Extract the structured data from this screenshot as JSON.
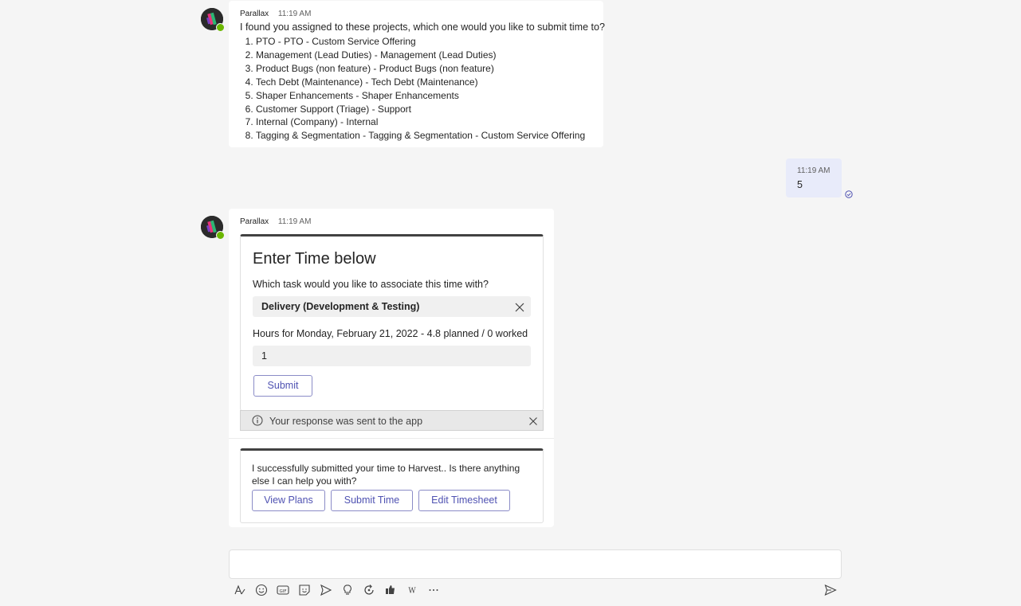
{
  "bot": {
    "name": "Parallax",
    "avatar_icon": "parallax-bot-icon",
    "presence_color": "#6bb700"
  },
  "message1": {
    "time": "11:19 AM",
    "text": "I found you assigned to these projects, which one would you like to submit time to?",
    "projects": [
      "PTO - PTO - Custom Service Offering",
      "Management (Lead Duties) - Management (Lead Duties)",
      "Product Bugs (non feature) - Product Bugs (non feature)",
      "Tech Debt (Maintenance) - Tech Debt (Maintenance)",
      "Shaper Enhancements - Shaper Enhancements",
      "Customer Support (Triage) - Support",
      "Internal (Company) - Internal",
      "Tagging & Segmentation - Tagging & Segmentation - Custom Service Offering"
    ]
  },
  "my_message": {
    "time": "11:19 AM",
    "text": "5",
    "status_icon": "read-receipt-icon"
  },
  "message2": {
    "time": "11:19 AM",
    "card": {
      "title": "Enter Time below",
      "task_question": "Which task would you like to associate this time with?",
      "task_value": "Delivery (Development & Testing)",
      "hours_label": "Hours for Monday, February 21, 2022 - 4.8 planned / 0 worked",
      "hours_value": "1",
      "submit_label": "Submit",
      "banner_text": "Your response was sent to the app"
    },
    "card2": {
      "text": "I successfully submitted your time to Harvest.. Is there anything else I can help you with?",
      "buttons": [
        "View Plans",
        "Submit Time",
        "Edit Timesheet"
      ]
    }
  },
  "compose": {
    "toolbar_icons": [
      "format-icon",
      "emoji-icon",
      "gif-icon",
      "sticker-icon",
      "schedule-send-icon",
      "praise-icon",
      "loop-icon",
      "approvals-icon",
      "wiki-icon",
      "more-options-icon"
    ],
    "send_icon": "send-icon"
  },
  "colors": {
    "accent": "#4f52b2",
    "my_bubble": "#e8ebfa",
    "background": "#f5f5f5"
  }
}
